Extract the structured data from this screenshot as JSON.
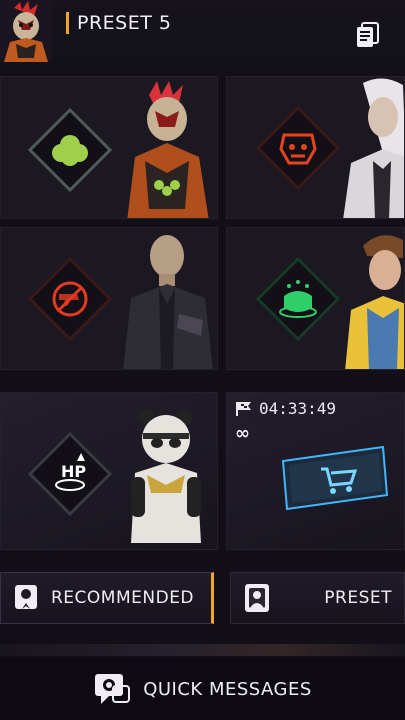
{
  "header": {
    "title": "PRESET 5",
    "avatar_icon": "rooster-character-avatar",
    "menu_icon": "document-list-icon",
    "accent_color": "#f5a431"
  },
  "cards": [
    {
      "skill_icon": "green-bush-icon",
      "character": "rooster-head-character",
      "color": "#9fd04a"
    },
    {
      "skill_icon": "tactical-mask-icon",
      "character": "white-hair-woman-character",
      "color": "#e8431f"
    },
    {
      "skill_icon": "no-weapon-icon",
      "character": "bald-man-character",
      "color": "#e33b22"
    },
    {
      "skill_icon": "green-drop-icon",
      "character": "brown-hair-boy-character",
      "color": "#2fd06a"
    },
    {
      "skill_icon": "hp-up-icon",
      "character": "panda-character",
      "color": "#ffffff"
    },
    {
      "timer": "04:33:49",
      "duration": "∞",
      "timer_icon": "flag-icon",
      "item": "cart-card-icon",
      "color": "#3fb7ff"
    }
  ],
  "tabs": {
    "recommended": "RECOMMENDED",
    "preset": "PRESET"
  },
  "footer": {
    "quick_messages": "QUICK MESSAGES",
    "icon": "chat-gear-icon"
  }
}
